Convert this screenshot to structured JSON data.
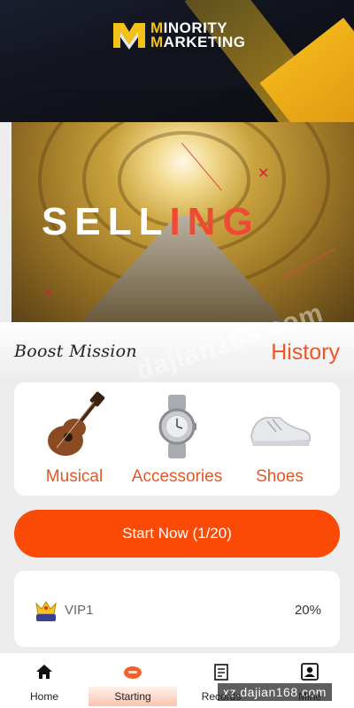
{
  "header": {
    "logo_line1": "MINORITY",
    "logo_line2": "MARKETING"
  },
  "banner": {
    "text_white": "SELL",
    "text_red": "ING"
  },
  "mission": {
    "title": "Boost Mission",
    "history_label": "History"
  },
  "categories": [
    {
      "label": "Musical",
      "icon": "ukulele-icon"
    },
    {
      "label": "Accessories",
      "icon": "watch-icon"
    },
    {
      "label": "Shoes",
      "icon": "sneaker-icon"
    }
  ],
  "start_button": {
    "label": "Start Now  (1/20)"
  },
  "vip": {
    "level": "VIP1",
    "percent": "20%"
  },
  "nav": {
    "items": [
      {
        "label": "Home",
        "icon": "home-icon"
      },
      {
        "label": "Starting",
        "icon": "starting-icon"
      },
      {
        "label": "Records",
        "icon": "records-icon"
      },
      {
        "label": "Mine",
        "icon": "profile-icon"
      }
    ],
    "active_index": 1
  },
  "watermark": {
    "center": "dajian168.com",
    "footer": "xz.dajian168.com"
  },
  "colors": {
    "accent": "#fa4a05",
    "history": "#f0542a",
    "category_label": "#e35626",
    "brand_gold": "#f2c21b"
  }
}
